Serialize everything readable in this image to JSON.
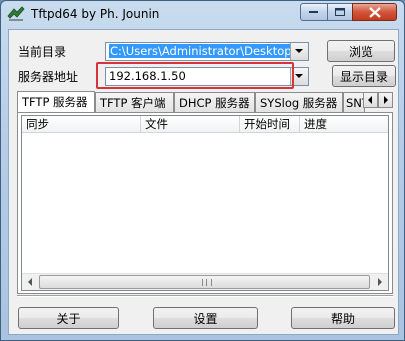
{
  "window": {
    "title": "Tftpd64 by Ph. Jounin"
  },
  "form": {
    "current_dir_label": "当前目录",
    "current_dir_value": "C:\\Users\\Administrator\\Desktop\\Tftpd",
    "server_if_label": "服务器地址",
    "server_if_value": "192.168.1.50",
    "browse_label": "浏览",
    "show_dir_label": "显示目录"
  },
  "tabs": [
    {
      "label": "TFTP 服务器",
      "active": true
    },
    {
      "label": "TFTP 客户端",
      "active": false
    },
    {
      "label": "DHCP 服务器",
      "active": false
    },
    {
      "label": "SYSlog 服务器",
      "active": false
    },
    {
      "label": "SNT",
      "active": false
    }
  ],
  "table": {
    "columns": [
      "同步",
      "文件",
      "开始时间",
      "进度"
    ]
  },
  "footer": {
    "about_label": "关于",
    "settings_label": "设置",
    "help_label": "帮助"
  }
}
